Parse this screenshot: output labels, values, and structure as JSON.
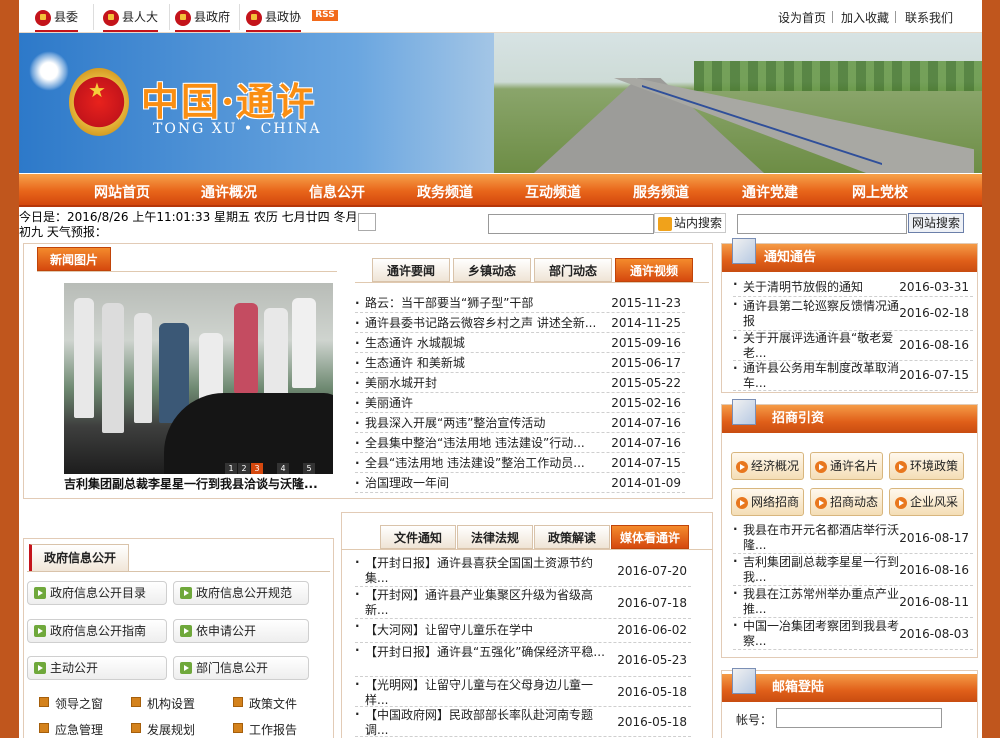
{
  "topbar": {
    "links": [
      "县委",
      "县人大",
      "县政府",
      "县政协"
    ],
    "rss": "RSS",
    "right_links": [
      "设为首页",
      "加入收藏",
      "联系我们"
    ]
  },
  "banner": {
    "title": "中国·通许",
    "subtitle": "TONG XU  •  CHINA"
  },
  "nav": [
    "网站首页",
    "通许概况",
    "信息公开",
    "政务频道",
    "互动频道",
    "服务频道",
    "通许党建",
    "网上党校"
  ],
  "date_line": "今日是：2016/8/26 上午11:01:33 星期五 农历 七月廿四 冬月初九 天气预报：",
  "search": {
    "site_button": "站内搜索",
    "web_button": "网站搜索"
  },
  "news_photo": {
    "header": "新闻图片",
    "caption": "吉利集团副总裁李星星一行到我县洽谈与沃隆...",
    "pages": [
      "1",
      "2",
      "3",
      "4",
      "5"
    ],
    "active_page": 3
  },
  "main_tabs": {
    "tabs": [
      "通许要闻",
      "乡镇动态",
      "部门动态",
      "通许视频"
    ],
    "active_index": 3,
    "items": [
      {
        "title": "路云：当干部要当“狮子型”干部",
        "date": "2015-11-23"
      },
      {
        "title": "通许县委书记路云微容乡村之声 讲述全新...",
        "date": "2014-11-25"
      },
      {
        "title": "生态通许 水城靓城",
        "date": "2015-09-16"
      },
      {
        "title": "生态通许 和美新城",
        "date": "2015-06-17"
      },
      {
        "title": "美丽水城开封",
        "date": "2015-05-22"
      },
      {
        "title": "美丽通许",
        "date": "2015-02-16"
      },
      {
        "title": "我县深入开展“两违”整治宣传活动",
        "date": "2014-07-16"
      },
      {
        "title": "全县集中整治“违法用地 违法建设”行动...",
        "date": "2014-07-16"
      },
      {
        "title": "全县“违法用地 违法建设”整治工作动员...",
        "date": "2014-07-15"
      },
      {
        "title": "治国理政一年间",
        "date": "2014-01-09"
      }
    ]
  },
  "notice": {
    "header": "通知通告",
    "items": [
      {
        "title": "关于清明节放假的通知",
        "date": "2016-03-31"
      },
      {
        "title": "通许县第二轮巡察反馈情况通报",
        "date": "2016-02-18"
      },
      {
        "title": "关于开展评选通许县“敬老爱老...",
        "date": "2016-08-16"
      },
      {
        "title": "通许县公务用车制度改革取消车...",
        "date": "2016-07-15"
      }
    ]
  },
  "investment": {
    "header": "招商引资",
    "buttons": [
      "经济概况",
      "通许名片",
      "环境政策",
      "网络招商",
      "招商动态",
      "企业风采"
    ],
    "items": [
      {
        "title": "我县在市开元名都酒店举行沃隆...",
        "date": "2016-08-17"
      },
      {
        "title": "吉利集团副总裁李星星一行到我...",
        "date": "2016-08-16"
      },
      {
        "title": "我县在江苏常州举办重点产业推...",
        "date": "2016-08-11"
      },
      {
        "title": "中国一冶集团考察团到我县考察...",
        "date": "2016-08-03"
      }
    ]
  },
  "mailbox": {
    "header": "邮箱登陆",
    "account_label": "帐号："
  },
  "gov_info": {
    "header": "政府信息公开",
    "buttons": [
      "政府信息公开目录",
      "政府信息公开规范",
      "政府信息公开指南",
      "依申请公开",
      "主动公开",
      "部门信息公开"
    ],
    "links": [
      "领导之窗",
      "机构设置",
      "政策文件",
      "应急管理",
      "发展规划",
      "工作报告"
    ]
  },
  "doc_tabs": {
    "tabs": [
      "文件通知",
      "法律法规",
      "政策解读",
      "媒体看通许"
    ],
    "active_index": 3,
    "items": [
      {
        "title": "【开封日报】通许县喜获全国国土资源节约集...",
        "date": "2016-07-20"
      },
      {
        "title": "【开封网】通许县产业集聚区升级为省级高新...",
        "date": "2016-07-18"
      },
      {
        "title": "【大河网】让留守儿童乐在学中",
        "date": "2016-06-02"
      },
      {
        "title": "【开封日报】通许县“五强化”确保经济平稳...",
        "date": "2016-05-23"
      },
      {
        "title": "【光明网】让留守儿童与在父母身边儿童一样...",
        "date": "2016-05-18"
      },
      {
        "title": "【中国政府网】民政部部长率队赴河南专题调...",
        "date": "2016-05-18"
      }
    ]
  },
  "colors": {
    "accent": "#e05f19",
    "nav_bg": "#e8651a",
    "frame": "#c0561d",
    "brand_red": "#c4141b"
  },
  "icons": [
    "party-emblem-icon",
    "national-emblem-icon",
    "search-icon",
    "notice-icon",
    "investment-icon",
    "mail-icon",
    "arrow-icon"
  ]
}
